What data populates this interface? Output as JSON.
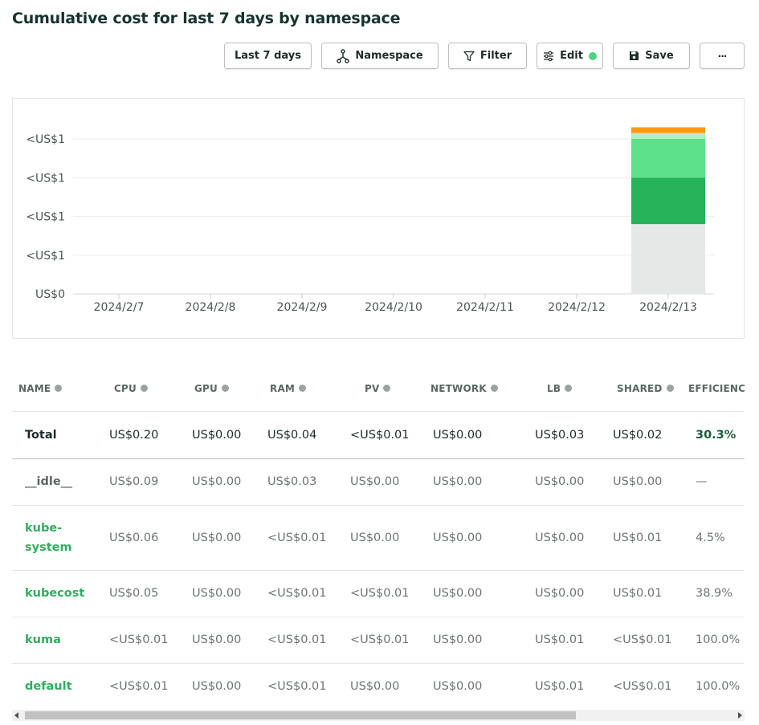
{
  "header": {
    "title": "Cumulative cost for last 7 days by namespace"
  },
  "toolbar": {
    "range_label": "Last 7 days",
    "aggregate_label": "Namespace",
    "aggregate_icon": "fork-icon",
    "filter_label": "Filter",
    "filter_icon": "filter-icon",
    "edit_label": "Edit",
    "edit_icon": "sliders-icon",
    "edit_status_color": "#4bd381",
    "save_label": "Save",
    "save_icon": "floppy-disk-icon",
    "more_label": "···"
  },
  "chart_data": {
    "type": "bar",
    "stacked": true,
    "categories": [
      "2024/2/7",
      "2024/2/8",
      "2024/2/9",
      "2024/2/10",
      "2024/2/11",
      "2024/2/12",
      "2024/2/13"
    ],
    "y_tick_labels": [
      "US$0",
      "<US$1",
      "<US$1",
      "<US$1",
      "<US$1"
    ],
    "ylim": [
      0,
      0.2
    ],
    "grid": true,
    "series": [
      {
        "color": "#e6e8e7",
        "values": [
          0,
          0,
          0,
          0,
          0,
          0,
          0.09
        ]
      },
      {
        "color": "#27b35a",
        "values": [
          0,
          0,
          0,
          0,
          0,
          0,
          0.06
        ]
      },
      {
        "color": "#5ce18a",
        "values": [
          0,
          0,
          0,
          0,
          0,
          0,
          0.05
        ]
      },
      {
        "color": "#b4efc6",
        "values": [
          0,
          0,
          0,
          0,
          0,
          0,
          0.0075
        ]
      },
      {
        "color": "#f39c12",
        "values": [
          0,
          0,
          0,
          0,
          0,
          0,
          0.0075
        ]
      }
    ]
  },
  "table": {
    "columns": [
      "NAME",
      "CPU",
      "GPU",
      "RAM",
      "PV",
      "NETWORK",
      "LB",
      "SHARED",
      "EFFICIENCY"
    ],
    "total": {
      "name": "Total",
      "cells": [
        "US$0.20",
        "US$0.00",
        "US$0.04",
        "<US$0.01",
        "US$0.00",
        "US$0.03",
        "US$0.02",
        "30.3%"
      ]
    },
    "rows": [
      {
        "name": "__idle__",
        "cells": [
          "US$0.09",
          "US$0.00",
          "US$0.03",
          "US$0.00",
          "US$0.00",
          "US$0.00",
          "US$0.00",
          "—"
        ]
      },
      {
        "name": "kube-system",
        "cells": [
          "US$0.06",
          "US$0.00",
          "<US$0.01",
          "US$0.00",
          "US$0.00",
          "US$0.00",
          "US$0.01",
          "4.5%"
        ]
      },
      {
        "name": "kubecost",
        "cells": [
          "US$0.05",
          "US$0.00",
          "<US$0.01",
          "<US$0.01",
          "US$0.00",
          "US$0.00",
          "US$0.01",
          "38.9%"
        ]
      },
      {
        "name": "kuma",
        "cells": [
          "<US$0.01",
          "US$0.00",
          "<US$0.01",
          "<US$0.01",
          "US$0.00",
          "US$0.01",
          "<US$0.01",
          "100.0%"
        ]
      },
      {
        "name": "default",
        "cells": [
          "<US$0.01",
          "US$0.00",
          "<US$0.01",
          "US$0.00",
          "US$0.00",
          "US$0.01",
          "<US$0.01",
          "100.0%"
        ]
      }
    ]
  }
}
